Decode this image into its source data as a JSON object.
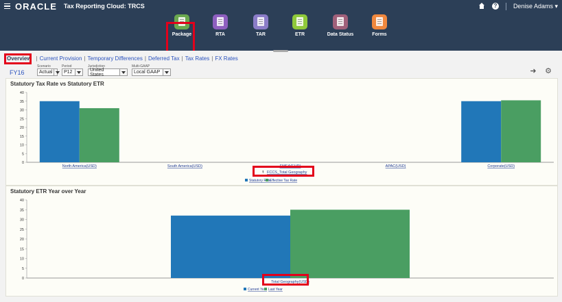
{
  "header": {
    "logo": "ORACLE",
    "app_title": "Tax Reporting Cloud: TRCS",
    "help_glyph": "?",
    "user": "Denise Adams"
  },
  "springboard": [
    {
      "label": "Package",
      "color": "#6aa84f",
      "name": "package"
    },
    {
      "label": "RTA",
      "color": "#8e5fbf",
      "name": "rta"
    },
    {
      "label": "TAR",
      "color": "#8b7cc8",
      "name": "tar"
    },
    {
      "label": "ETR",
      "color": "#8fc93a",
      "name": "etr"
    },
    {
      "label": "Data Status",
      "color": "#a0607a",
      "name": "data-status"
    },
    {
      "label": "Forms",
      "color": "#f0883e",
      "name": "forms"
    }
  ],
  "tabs": [
    "Overview",
    "Current Provision",
    "Temporary Differences",
    "Deferred Tax",
    "Tax Rates",
    "FX Rates"
  ],
  "pov": {
    "year": "FY16",
    "scenario": {
      "label": "Scenario",
      "value": "Actual"
    },
    "period": {
      "label": "Period",
      "value": "P12"
    },
    "jurisdiction": {
      "label": "Jurisdiction",
      "value": "United States"
    },
    "multigaap": {
      "label": "Multi-GAAP",
      "value": "Local GAAP"
    },
    "arrow_glyph": "➜",
    "gear_glyph": "⚙"
  },
  "colors": {
    "blue": "#2177b8",
    "green": "#4a9e62"
  },
  "chart_data": [
    {
      "type": "bar",
      "title": "Statutory Tax Rate vs Statutory ETR",
      "categories": [
        "North America(USD)",
        "South America(USD)",
        "EMEA(EUR)",
        "APAC(USD)",
        "Corporate(USD)"
      ],
      "series": [
        {
          "name": "Statutory Rate",
          "values": [
            35,
            0,
            0,
            0,
            35
          ]
        },
        {
          "name": "Effective Tax Rate",
          "values": [
            31,
            0,
            0,
            0,
            35.5
          ]
        }
      ],
      "ylim": [
        0,
        40
      ],
      "yticks": [
        0,
        5,
        10,
        15,
        20,
        25,
        30,
        35,
        40
      ],
      "filter_label": "FCCS_Total Geography",
      "legend_position": "bottom"
    },
    {
      "type": "bar",
      "title": "Statutory ETR Year over Year",
      "categories": [
        "Total Geography(USD)"
      ],
      "series": [
        {
          "name": "Current Year",
          "values": [
            32
          ]
        },
        {
          "name": "Last Year",
          "values": [
            35
          ]
        }
      ],
      "ylim": [
        0,
        40
      ],
      "yticks": [
        0,
        5,
        10,
        15,
        20,
        25,
        30,
        35,
        40
      ],
      "legend_position": "bottom"
    }
  ]
}
